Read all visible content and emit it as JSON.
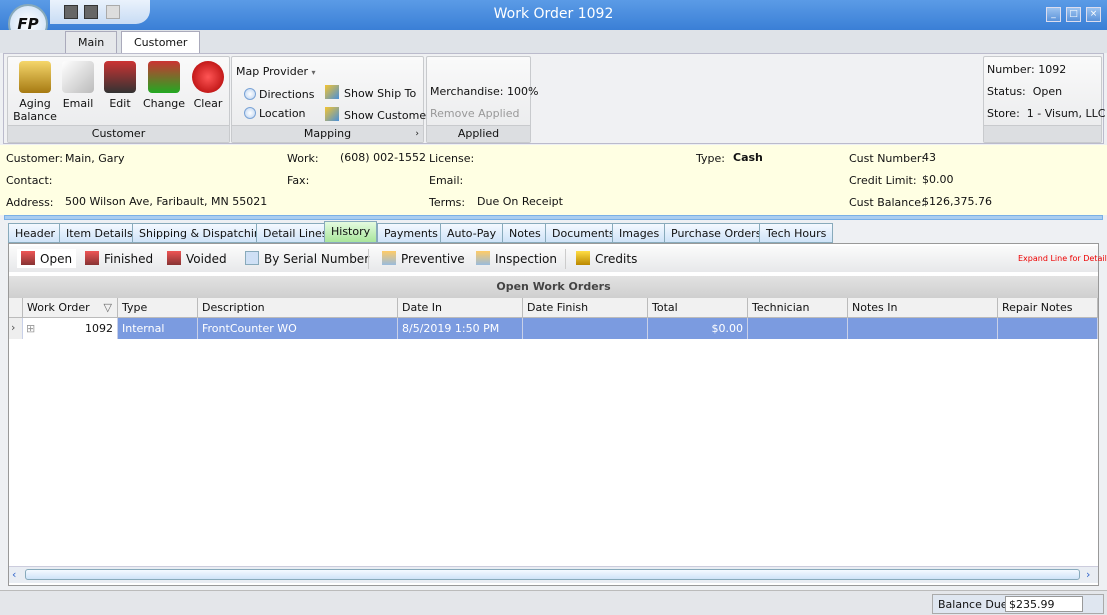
{
  "window": {
    "title": "Work Order 1092",
    "logo_text": "FP"
  },
  "ribbon_tabs": [
    "Main",
    "Customer"
  ],
  "ribbon": {
    "customer_group": {
      "label": "Customer",
      "buttons": [
        "Aging Balance",
        "Email",
        "Edit",
        "Change",
        "Clear"
      ]
    },
    "mapping_group": {
      "label": "Mapping",
      "map_provider": "Map Provider",
      "directions": "Directions",
      "location": "Location",
      "show_ship_to": "Show Ship To",
      "show_customer": "Show Customer"
    },
    "applied_group": {
      "label": "Applied Percentages",
      "merchandise": "Merchandise: 100%",
      "remove_applied": "Remove Applied"
    },
    "summary": {
      "number_label": "Number:",
      "number": "1092",
      "status_label": "Status:",
      "status": "Open",
      "store_label": "Store:",
      "store": "1 - Visum, LLC"
    }
  },
  "customer_info": {
    "customer_label": "Customer:",
    "customer": "Main, Gary",
    "contact_label": "Contact:",
    "contact": "",
    "address_label": "Address:",
    "address": "500 Wilson Ave, Faribault, MN 55021",
    "work_label": "Work:",
    "work": "(608) 002-1552",
    "fax_label": "Fax:",
    "fax": "",
    "license_label": "License:",
    "license": "",
    "email_label": "Email:",
    "email": "",
    "terms_label": "Terms:",
    "terms": "Due On Receipt",
    "type_label": "Type:",
    "type": "Cash",
    "cust_number_label": "Cust Number:",
    "cust_number": "43",
    "credit_limit_label": "Credit Limit:",
    "credit_limit": "$0.00",
    "cust_balance_label": "Cust Balance:",
    "cust_balance": "$126,375.76"
  },
  "tabs": [
    "Header",
    "Item Details",
    "Shipping & Dispatching",
    "Detail Lines",
    "History",
    "Payments",
    "Auto-Pay",
    "Notes",
    "Documents",
    "Images",
    "Purchase Orders",
    "Tech Hours"
  ],
  "active_tab": "History",
  "toolbar": {
    "open": "Open",
    "finished": "Finished",
    "voided": "Voided",
    "by_serial": "By Serial Number",
    "preventive": "Preventive",
    "inspection": "Inspection",
    "credits": "Credits",
    "hint": "Expand Line for Detail"
  },
  "grid": {
    "group_title": "Open Work Orders",
    "columns": [
      "Work Order",
      "Type",
      "Description",
      "Date In",
      "Date Finish",
      "Total",
      "Technician",
      "Notes In",
      "Repair Notes"
    ],
    "rows": [
      [
        "1092",
        "Internal",
        "FrontCounter WO",
        "8/5/2019 1:50 PM",
        "",
        "$0.00",
        "",
        "",
        ""
      ]
    ]
  },
  "status": {
    "balance_due_label": "Balance Due:",
    "balance_due": "$235.99"
  }
}
